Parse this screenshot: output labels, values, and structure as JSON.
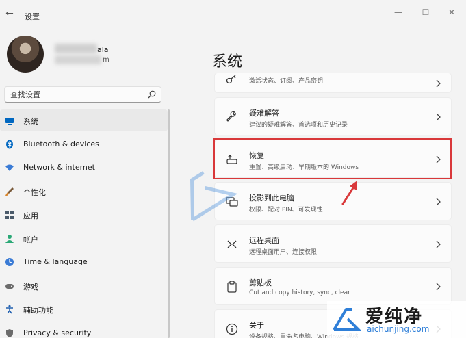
{
  "window": {
    "title": "设置",
    "back_glyph": "←",
    "min_glyph": "—",
    "max_glyph": "☐",
    "close_glyph": "✕"
  },
  "account": {
    "name_tail": "ala",
    "email_tail": "m"
  },
  "search": {
    "placeholder": "查找设置"
  },
  "sidebar": {
    "items": [
      {
        "label": "系统",
        "icon": "monitor-icon",
        "color": "#0067c0",
        "active": true
      },
      {
        "label": "Bluetooth & devices",
        "icon": "bluetooth-icon",
        "color": "#0067c0"
      },
      {
        "label": "Network & internet",
        "icon": "wifi-icon",
        "color": "#3a7bd5"
      },
      {
        "label": "个性化",
        "icon": "brush-icon",
        "color": "#d8862e"
      },
      {
        "label": "应用",
        "icon": "apps-icon",
        "color": "#4a5a6a"
      },
      {
        "label": "帐户",
        "icon": "person-icon",
        "color": "#2aa876"
      },
      {
        "label": "Time & language",
        "icon": "globe-clock-icon",
        "color": "#3a7bd5"
      },
      {
        "label": "游戏",
        "icon": "gamepad-icon",
        "color": "#6b6b6b"
      },
      {
        "label": "辅助功能",
        "icon": "accessibility-icon",
        "color": "#2160b0"
      },
      {
        "label": "Privacy & security",
        "icon": "shield-icon",
        "color": "#6b6b6b"
      }
    ]
  },
  "main": {
    "title": "系统",
    "cards": [
      {
        "title": "",
        "subtitle": "激活状态、订阅、产品密钥",
        "icon": "key-icon"
      },
      {
        "title": "疑难解答",
        "subtitle": "建议的疑难解答、首选项和历史记录",
        "icon": "wrench-icon"
      },
      {
        "title": "恢复",
        "subtitle": "重置、高级启动、早期版本的 Windows",
        "icon": "recovery-icon",
        "highlighted": true
      },
      {
        "title": "投影到此电脑",
        "subtitle": "权限、配对 PIN、可发现性",
        "icon": "project-icon"
      },
      {
        "title": "远程桌面",
        "subtitle": "远程桌面用户、连接权限",
        "icon": "remote-desktop-icon"
      },
      {
        "title": "剪贴板",
        "subtitle": "Cut and copy history, sync, clear",
        "icon": "clipboard-icon"
      },
      {
        "title": "关于",
        "subtitle": "设备规格、重命名电脑、Windows 规格",
        "icon": "info-icon"
      }
    ]
  },
  "watermark": {
    "brand": "爱纯净",
    "url": "aichunjing.com",
    "accent": "#2f7fd8"
  },
  "annotation": {
    "highlight_color": "#d9383a"
  }
}
